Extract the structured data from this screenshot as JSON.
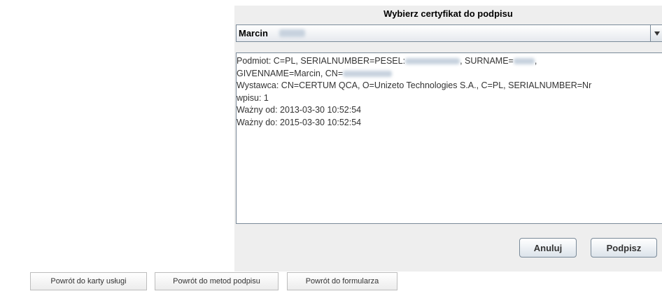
{
  "dialog": {
    "title": "Wybierz certyfikat do podpisu",
    "combo_value": "Marcin",
    "details_lines": [
      {
        "before": "Podmiot: C=PL, SERIALNUMBER=PESEL:",
        "after": ", SURNAME=",
        "after2": ","
      },
      {
        "before": "GIVENNAME=Marcin, CN=",
        "after": ""
      },
      {
        "text": "Wystawca: CN=CERTUM QCA, O=Unizeto Technologies S.A., C=PL, SERIALNUMBER=Nr"
      },
      {
        "text": "wpisu: 1"
      },
      {
        "text": "Ważny od: 2013-03-30 10:52:54"
      },
      {
        "text": "Ważny do: 2015-03-30 10:52:54"
      }
    ],
    "cancel_label": "Anuluj",
    "sign_label": "Podpisz"
  },
  "nav": {
    "back_to_service": "Powrót do karty usługi",
    "back_to_methods": "Powrót do metod podpisu",
    "back_to_form": "Powrót do formularza"
  }
}
